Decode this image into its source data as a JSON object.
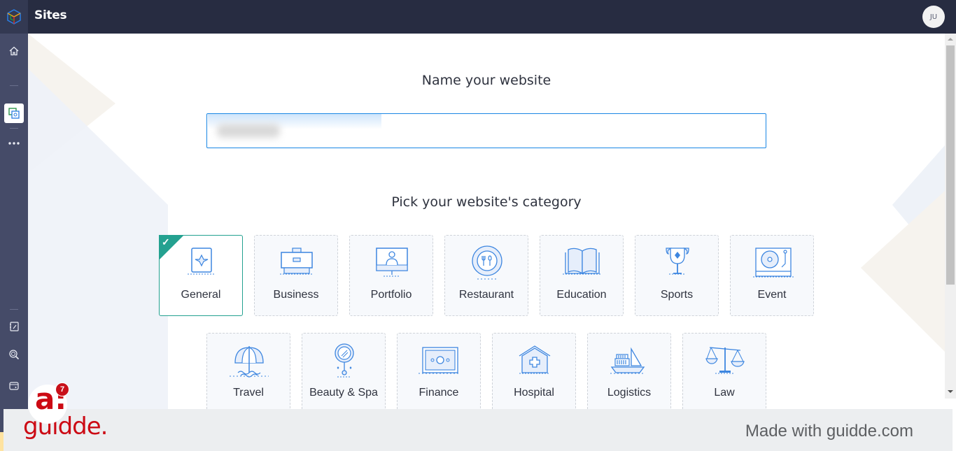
{
  "app": {
    "title": "Sites",
    "logo_icon": "cube-logo-icon",
    "user_initials": "JU"
  },
  "sidebar": {
    "items": [
      {
        "name": "home",
        "icon": "home-icon",
        "active": false
      },
      {
        "name": "sites",
        "icon": "sites-icon",
        "active": true
      },
      {
        "name": "more",
        "icon": "more-dots-icon",
        "active": false
      },
      {
        "name": "notebook",
        "icon": "notebook-icon",
        "active": false
      },
      {
        "name": "search-inspect",
        "icon": "search-inspect-icon",
        "active": false
      },
      {
        "name": "wallet",
        "icon": "wallet-icon",
        "active": false
      }
    ]
  },
  "main": {
    "name_heading": "Name your website",
    "name_input": {
      "value": "",
      "placeholder": "",
      "note": "value obscured/blurred"
    },
    "category_heading": "Pick your website's category",
    "selected_category": "General",
    "categories_row1": [
      {
        "label": "General",
        "icon": "general-sparkle-icon",
        "selected": true
      },
      {
        "label": "Business",
        "icon": "briefcase-icon",
        "selected": false
      },
      {
        "label": "Portfolio",
        "icon": "monitor-person-icon",
        "selected": false
      },
      {
        "label": "Restaurant",
        "icon": "plate-fork-icon",
        "selected": false
      },
      {
        "label": "Education",
        "icon": "open-book-icon",
        "selected": false
      },
      {
        "label": "Sports",
        "icon": "trophy-icon",
        "selected": false
      },
      {
        "label": "Event",
        "icon": "turntable-icon",
        "selected": false
      }
    ],
    "categories_row2": [
      {
        "label": "Travel",
        "icon": "beach-umbrella-icon",
        "selected": false
      },
      {
        "label": "Beauty & Spa",
        "icon": "hand-mirror-icon",
        "selected": false
      },
      {
        "label": "Finance",
        "icon": "banknote-icon",
        "selected": false
      },
      {
        "label": "Hospital",
        "icon": "hospital-icon",
        "selected": false
      },
      {
        "label": "Logistics",
        "icon": "cargo-ship-icon",
        "selected": false
      },
      {
        "label": "Law",
        "icon": "scales-icon",
        "selected": false
      }
    ]
  },
  "colors": {
    "topbar": "#272c41",
    "sidebar": "#454b68",
    "accent_selected": "#24a190",
    "input_border": "#1a87e5",
    "icon_blue": "#3d86e0",
    "guidde_red": "#cc0a14"
  },
  "footer": {
    "brand": "guidde.",
    "badge_letter": "a:",
    "notification_count": "7",
    "made_with": "Made with guidde.com"
  }
}
